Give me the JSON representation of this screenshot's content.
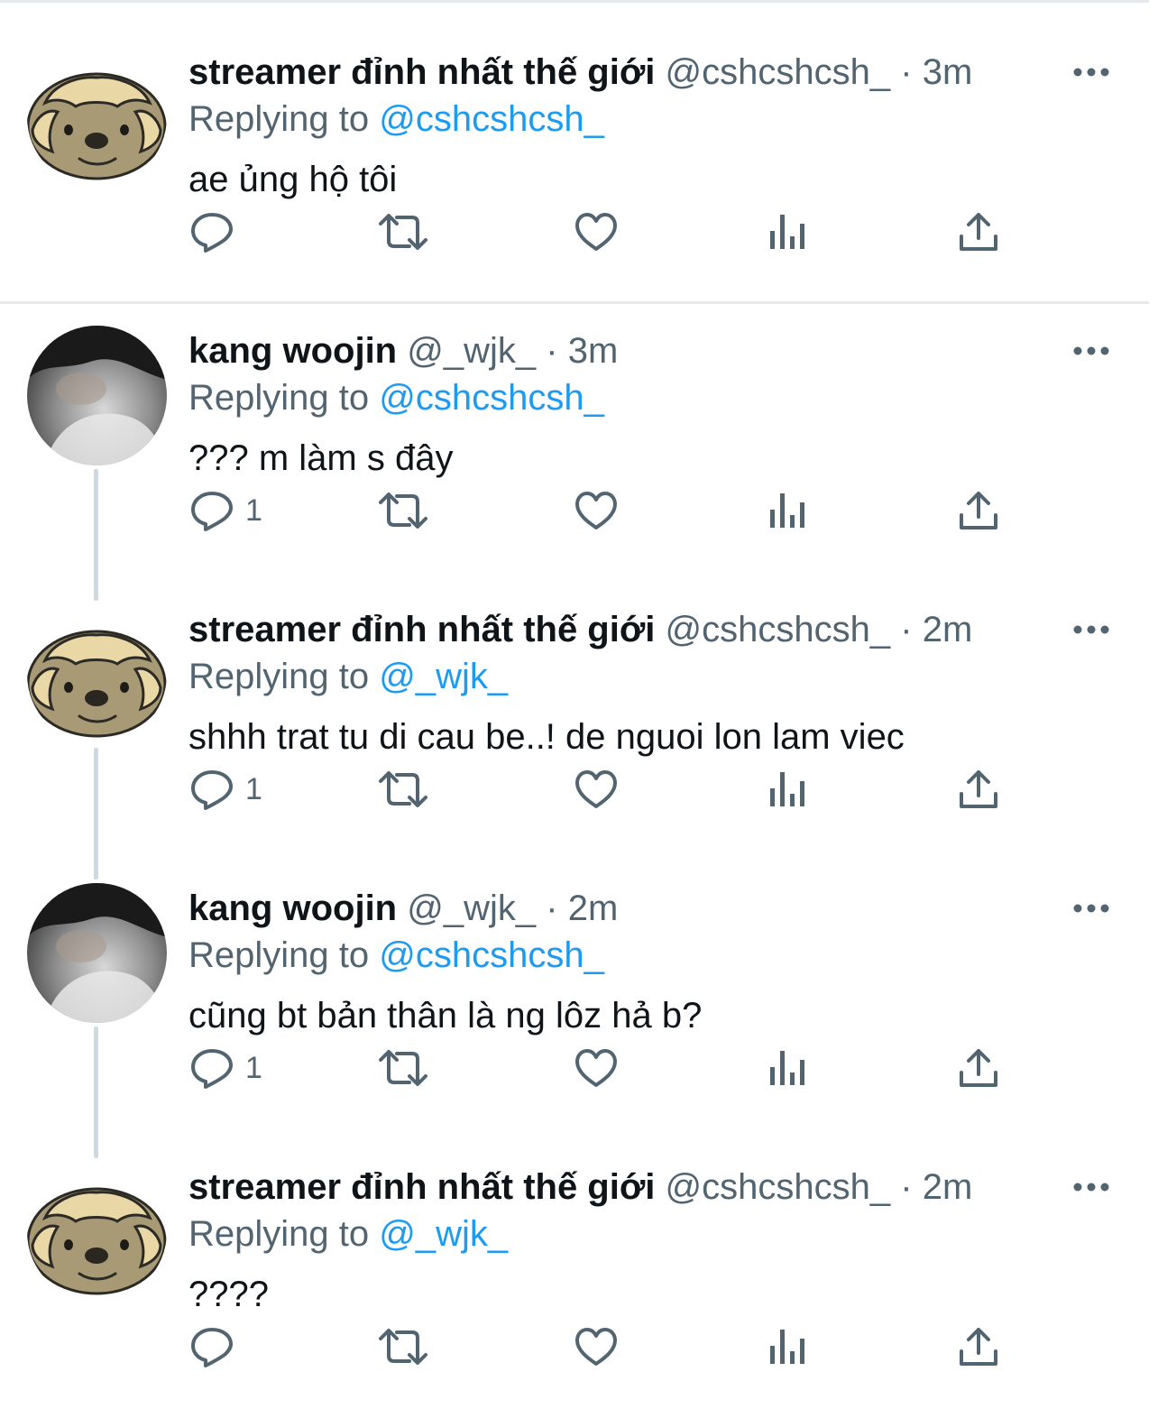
{
  "tweets": [
    {
      "display_name": "streamer đỉnh nhất thế giới",
      "handle": "@cshcshcsh_",
      "separator": "·",
      "time": "3m",
      "replying_prefix": "Replying to ",
      "replying_to": "@cshcshcsh_",
      "text": "ae ủng hộ tôi",
      "reply_count": "",
      "avatar": "sloth-avatar"
    },
    {
      "display_name": "kang woojin",
      "handle": "@_wjk_",
      "separator": "·",
      "time": "3m",
      "replying_prefix": "Replying to ",
      "replying_to": "@cshcshcsh_",
      "text": "??? m làm s đây",
      "reply_count": "1",
      "avatar": "photo-avatar"
    },
    {
      "display_name": "streamer đỉnh nhất thế giới",
      "handle": "@cshcshcsh_",
      "separator": "·",
      "time": "2m",
      "replying_prefix": "Replying to ",
      "replying_to": "@_wjk_",
      "text": "shhh trat tu di cau be..! de nguoi lon lam viec",
      "reply_count": "1",
      "avatar": "sloth-avatar"
    },
    {
      "display_name": "kang woojin",
      "handle": "@_wjk_",
      "separator": "·",
      "time": "2m",
      "replying_prefix": "Replying to ",
      "replying_to": "@cshcshcsh_",
      "text": "cũng bt bản thân là ng lôz hả b?",
      "reply_count": "1",
      "avatar": "photo-avatar"
    },
    {
      "display_name": "streamer đỉnh nhất thế giới",
      "handle": "@cshcshcsh_",
      "separator": "·",
      "time": "2m",
      "replying_prefix": "Replying to ",
      "replying_to": "@_wjk_",
      "text": "????",
      "reply_count": "",
      "avatar": "sloth-avatar"
    }
  ],
  "icons": {
    "reply": "reply-icon",
    "retweet": "retweet-icon",
    "like": "heart-icon",
    "views": "views-icon",
    "share": "share-icon",
    "more": "more-icon"
  },
  "colors": {
    "text": "#0f1419",
    "secondary": "#536471",
    "link": "#1d9bf0",
    "divider": "#e6e9eb",
    "thread_line": "#cfd9de",
    "sloth_fur": "#a99a76"
  }
}
